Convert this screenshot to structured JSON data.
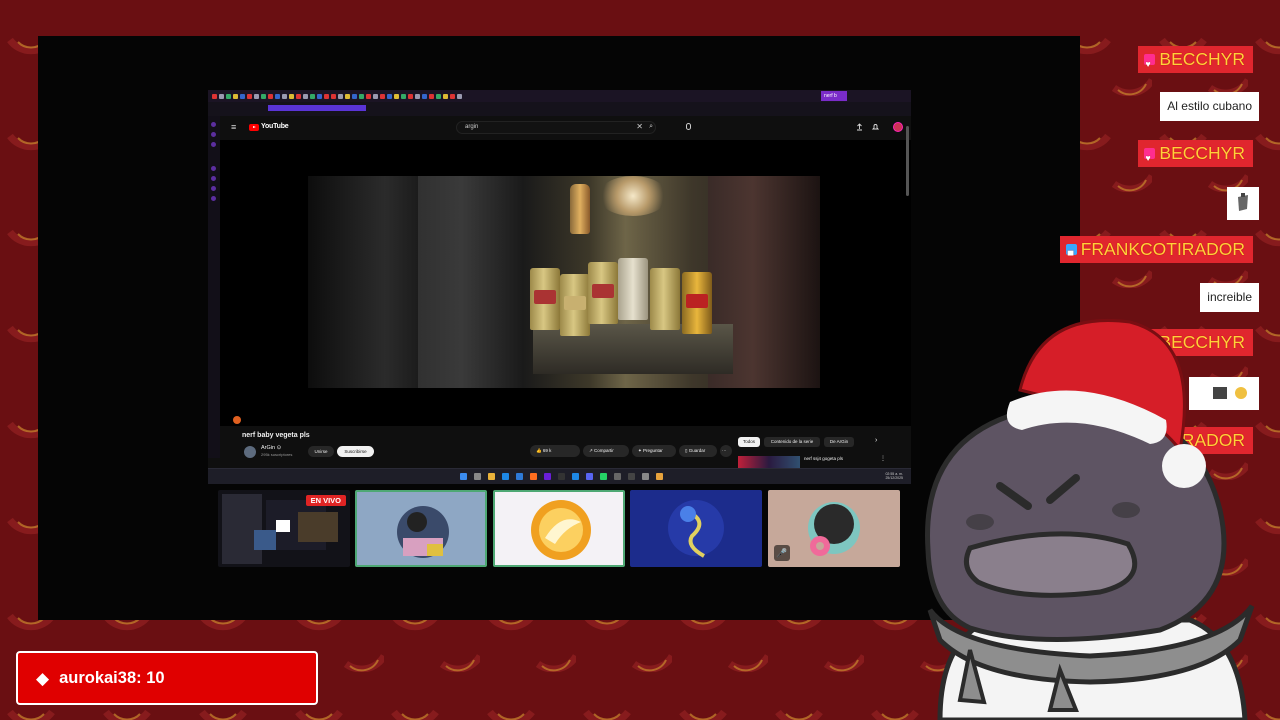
{
  "browser": {
    "active_tab_label": "nerf b",
    "youtube": {
      "logo_text": "YouTube",
      "menu_glyph": "≡",
      "search_query": "argin",
      "clear_glyph": "✕",
      "search_glyph": "⌕",
      "video_title": "nerf baby vegeta pls",
      "channel_name": "ArGin ⊙",
      "channel_subs": "295k suscriptores",
      "join_label": "Unirse",
      "subscribe_label": "Suscribirse",
      "like_count": "69 k",
      "share_label": "Compartir",
      "ask_label": "Preguntar",
      "save_label": "Guardar",
      "more_glyph": "⋯",
      "chips": [
        "Todos",
        "Contenido de la serie",
        "De ArGin"
      ],
      "chip_next_glyph": "›",
      "recommended_title": "nerf ssj4 gogeta pls"
    },
    "taskbar": {
      "tray_time": "02:55 a. m.",
      "tray_date": "25/12/2025"
    }
  },
  "scene_switcher": {
    "live_badge": "EN VIVO",
    "mute_glyph": "🎤"
  },
  "chat": [
    {
      "type": "name",
      "badge": "heart-badge",
      "text": "BECCHYR"
    },
    {
      "type": "message",
      "text": "Al estilo cubano"
    },
    {
      "type": "name",
      "badge": "heart-badge",
      "text": "BECCHYR"
    },
    {
      "type": "emote",
      "icon": "emote-icon"
    },
    {
      "type": "name",
      "badge": "tv-badge",
      "text": "FRANKCOTIRADOR"
    },
    {
      "type": "message",
      "text": "increible"
    },
    {
      "type": "name",
      "badge": "heart-badge",
      "text": "BECCHYR"
    },
    {
      "type": "emote",
      "icon": "emote-icon"
    },
    {
      "type": "name",
      "badge": "tv-badge",
      "text": "FRANKCOTIRADOR"
    }
  ],
  "alert": {
    "icon": "gem-icon",
    "text": "aurokai38: 10"
  },
  "colors": {
    "chat_name_bg": "#e0262e",
    "chat_name_fg": "#ffd13a",
    "alert_bg": "#e00000",
    "background": "#6a0f12",
    "selected_scene_border": "#4ea874"
  }
}
